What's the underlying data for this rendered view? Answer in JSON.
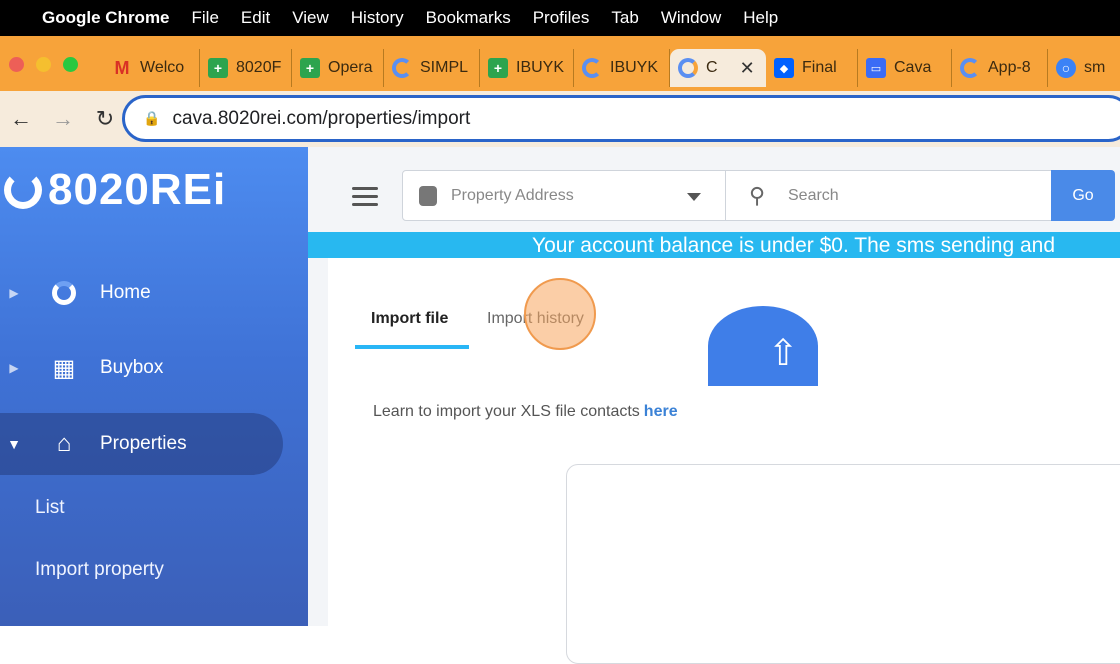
{
  "menubar": {
    "app": "Google Chrome",
    "items": [
      "File",
      "Edit",
      "View",
      "History",
      "Bookmarks",
      "Profiles",
      "Tab",
      "Window",
      "Help"
    ]
  },
  "tabs": [
    {
      "label": "Welco",
      "icon": "gmail-icon"
    },
    {
      "label": "8020F",
      "icon": "sheets-icon"
    },
    {
      "label": "Opera",
      "icon": "sheets-icon"
    },
    {
      "label": "SIMPL",
      "icon": "ring-icon"
    },
    {
      "label": "IBUYK",
      "icon": "sheets-icon"
    },
    {
      "label": "IBUYK",
      "icon": "ring-icon"
    },
    {
      "label": "C",
      "icon": "ring-icon",
      "active": true
    },
    {
      "label": "Final",
      "icon": "dropbox-icon"
    },
    {
      "label": "Cava",
      "icon": "cava-icon"
    },
    {
      "label": "App-8",
      "icon": "ring-icon"
    },
    {
      "label": "sm",
      "icon": "search-icon"
    }
  ],
  "url": "cava.8020rei.com/properties/import",
  "sidebar": {
    "logo": "8020REi",
    "items": [
      {
        "label": "Home",
        "icon": "home-ring-icon"
      },
      {
        "label": "Buybox",
        "icon": "boxes-icon"
      },
      {
        "label": "Properties",
        "icon": "house-icon"
      }
    ],
    "subitems": [
      "List",
      "Import property"
    ]
  },
  "topbar": {
    "property_placeholder": "Property Address",
    "search_placeholder": "Search",
    "go_label": "Go"
  },
  "banner": "Your account balance is under $0. The sms sending and",
  "main": {
    "tabs": [
      "Import file",
      "Import history"
    ],
    "learn_text": "Learn to import your XLS file contacts",
    "learn_link": "here"
  }
}
